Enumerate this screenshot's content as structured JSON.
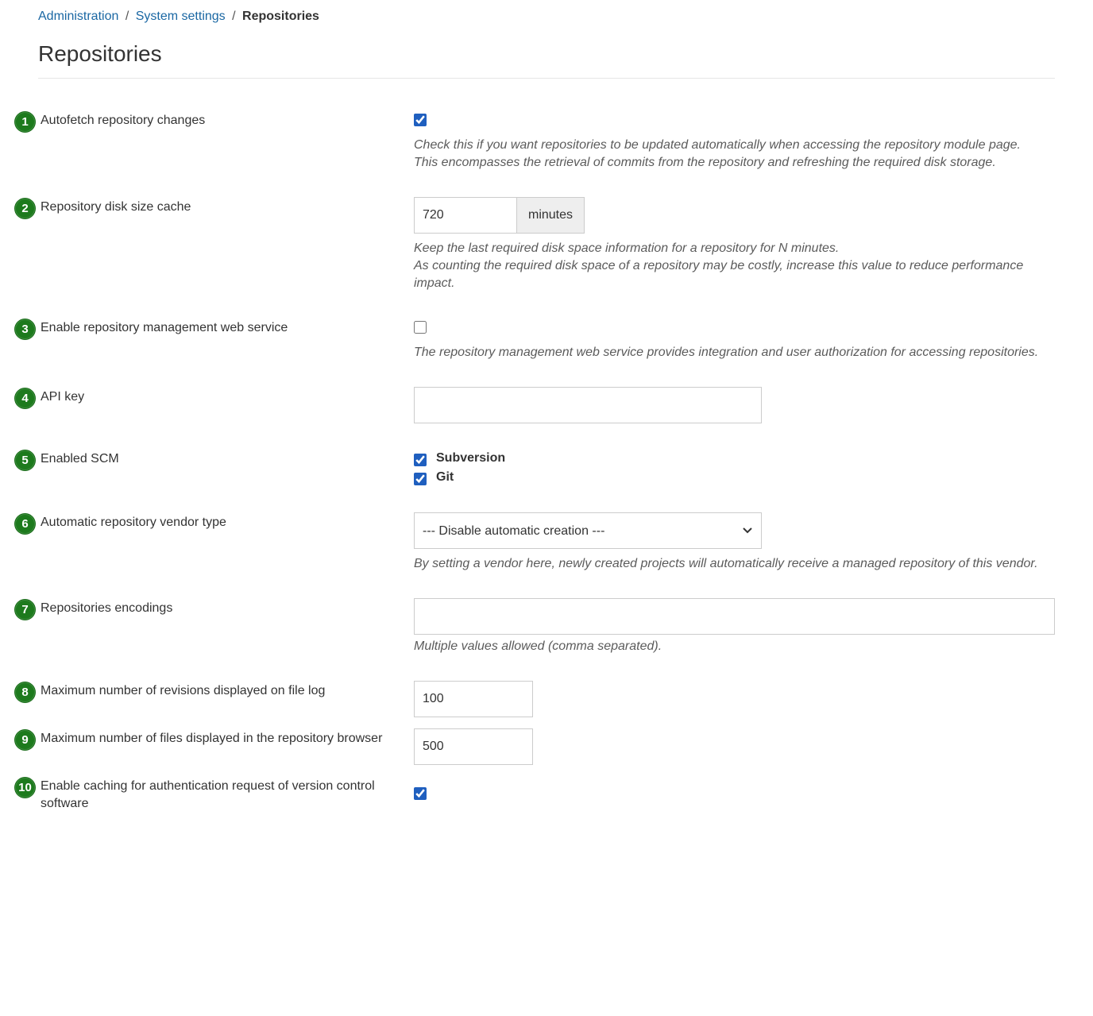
{
  "breadcrumb": {
    "items": [
      {
        "label": "Administration"
      },
      {
        "label": "System settings"
      }
    ],
    "current": "Repositories",
    "sep": "/"
  },
  "page_title": "Repositories",
  "rows": {
    "r1": {
      "num": "1",
      "label": "Autofetch repository changes",
      "hint1": "Check this if you want repositories to be updated automatically when accessing the repository module page.",
      "hint2": "This encompasses the retrieval of commits from the repository and refreshing the required disk storage."
    },
    "r2": {
      "num": "2",
      "label": "Repository disk size cache",
      "value": "720",
      "unit": "minutes",
      "hint1": "Keep the last required disk space information for a repository for N minutes.",
      "hint2": "As counting the required disk space of a repository may be costly, increase this value to reduce performance impact."
    },
    "r3": {
      "num": "3",
      "label": "Enable repository management web service",
      "hint": "The repository management web service provides integration and user authorization for accessing repositories."
    },
    "r4": {
      "num": "4",
      "label": "API key",
      "value": ""
    },
    "r5": {
      "num": "5",
      "label": "Enabled SCM",
      "opt1": "Subversion",
      "opt2": "Git"
    },
    "r6": {
      "num": "6",
      "label": "Automatic repository vendor type",
      "selected": "--- Disable automatic creation ---",
      "hint": "By setting a vendor here, newly created projects will automatically receive a managed repository of this vendor."
    },
    "r7": {
      "num": "7",
      "label": "Repositories encodings",
      "value": "",
      "hint": "Multiple values allowed (comma separated)."
    },
    "r8": {
      "num": "8",
      "label": "Maximum number of revisions displayed on file log",
      "value": "100"
    },
    "r9": {
      "num": "9",
      "label": "Maximum number of files displayed in the repository browser",
      "value": "500"
    },
    "r10": {
      "num": "10",
      "label": "Enable caching for authentication request of version control software"
    }
  }
}
